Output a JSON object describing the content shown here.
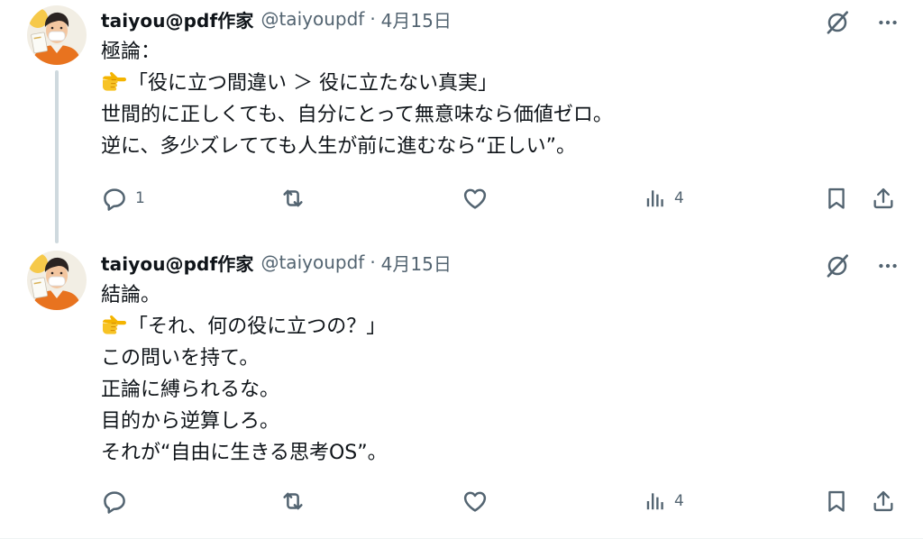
{
  "colors": {
    "text": "#0f1419",
    "secondary": "#536471",
    "thread_line": "#cfd9de"
  },
  "tweets": [
    {
      "author": {
        "display_name": "taiyou@pdf作家",
        "handle": "@taiyoupdf",
        "separator": "·",
        "date": "4月15日"
      },
      "lines": [
        {
          "text": "極論："
        },
        {
          "emoji": "pointing-right-hand-icon",
          "text": "「役に立つ間違い ＞ 役に立たない真実」"
        },
        {
          "text": "世間的に正しくても、自分にとって無意味なら価値ゼロ。"
        },
        {
          "text": "逆に、多少ズレてても人生が前に進むなら“正しい”。"
        }
      ],
      "stats": {
        "replies": "1",
        "views": "4"
      }
    },
    {
      "author": {
        "display_name": "taiyou@pdf作家",
        "handle": "@taiyoupdf",
        "separator": "·",
        "date": "4月15日"
      },
      "lines": [
        {
          "text": "結論。"
        },
        {
          "emoji": "pointing-right-hand-icon",
          "text": "「それ、何の役に立つの？」"
        },
        {
          "text": "この問いを持て。"
        },
        {
          "text": "正論に縛られるな。"
        },
        {
          "text": "目的から逆算しろ。"
        },
        {
          "text": "それが“自由に生きる思考OS”。"
        }
      ],
      "stats": {
        "replies": "",
        "views": "4"
      }
    }
  ]
}
